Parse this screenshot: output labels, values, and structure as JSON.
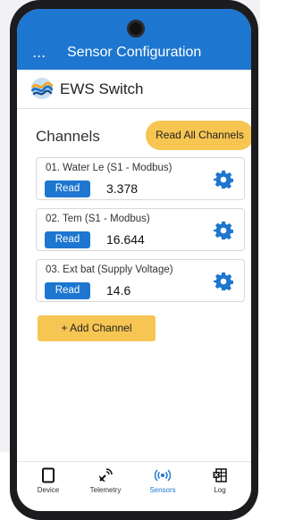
{
  "app": {
    "menu_dots": "···",
    "title": "Sensor Configuration"
  },
  "brand": {
    "name": "EWS Switch",
    "logo_icon": "ews-wave-logo"
  },
  "channels_section": {
    "title": "Channels",
    "read_all_label": "Read All Channels",
    "add_channel_label": "+ Add Channel"
  },
  "channels": [
    {
      "label": "01. Water Le (S1 - Modbus)",
      "read_label": "Read",
      "value": "3.378"
    },
    {
      "label": "02. Tem (S1 - Modbus)",
      "read_label": "Read",
      "value": "16.644"
    },
    {
      "label": "03. Ext bat (Supply Voltage)",
      "read_label": "Read",
      "value": "14.6"
    }
  ],
  "bottom_nav": [
    {
      "label": "Device",
      "icon": "device-icon",
      "active": false
    },
    {
      "label": "Telemetry",
      "icon": "satellite-dish-icon",
      "active": false
    },
    {
      "label": "Sensors",
      "icon": "broadcast-icon",
      "active": true
    },
    {
      "label": "Log",
      "icon": "spreadsheet-icon",
      "active": false
    }
  ],
  "colors": {
    "primary": "#1d76cf",
    "accent": "#f6c552",
    "phone_frame": "#1c1c1e"
  }
}
